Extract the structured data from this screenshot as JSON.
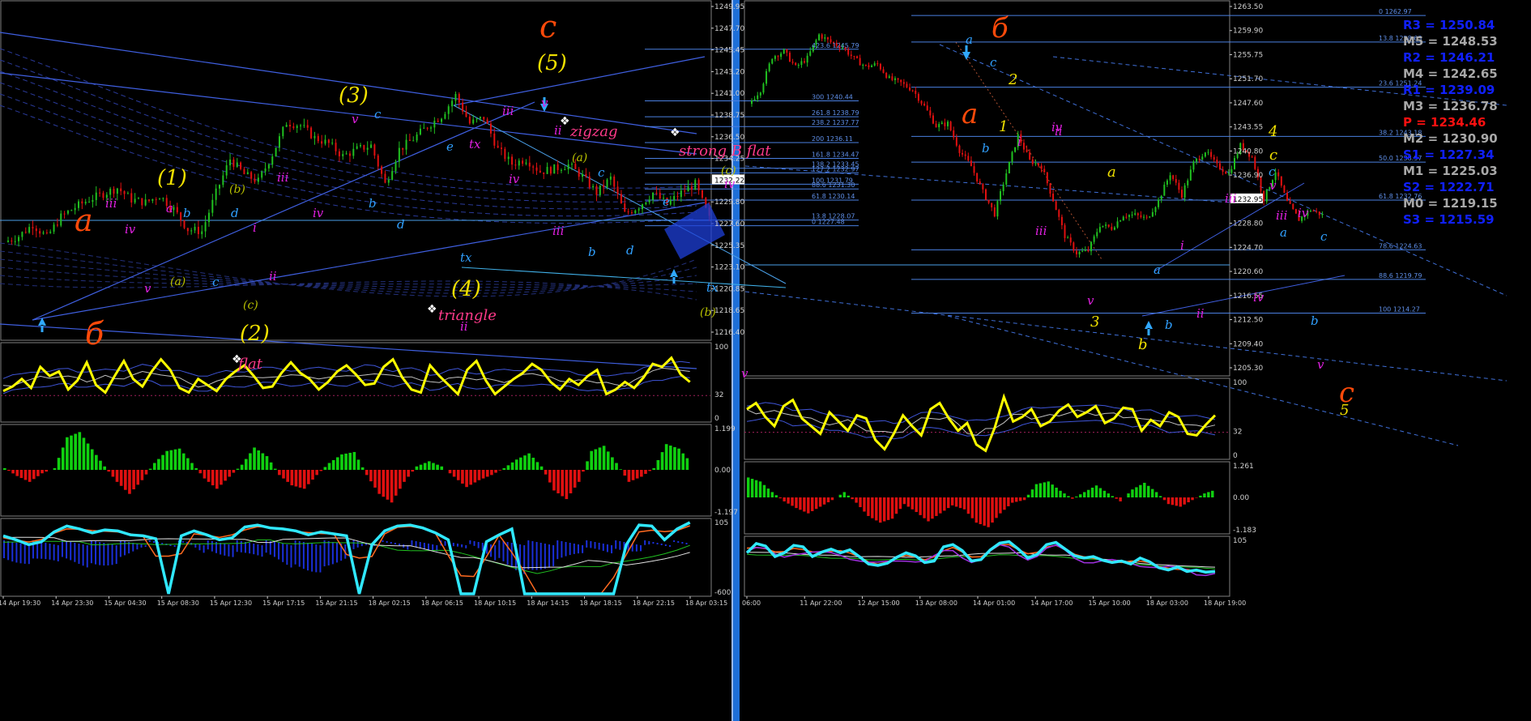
{
  "colors": {
    "background": "#000000",
    "panel_border": "#7f7f7f",
    "window_separator": "#1e6fd8",
    "price_axis_text": "#d0d0d0",
    "trendline": "#3f5fe0",
    "fib_line": "#4a7fe0",
    "wave_orange": "#ff4a0a",
    "wave_yellow": "#f0e000",
    "wave_magenta": "#e020e0",
    "wave_cyan": "#30a0ff",
    "wave_olive": "#b8c000",
    "candle_up": "#20c020",
    "candle_down": "#e01010",
    "osc_main": "#ffff00",
    "hist_up": "#10d010",
    "hist_down": "#e01010",
    "osc_cyan": "#30e8ff",
    "pivot_blue": "#1020ff",
    "pivot_gray": "#a8a8a8",
    "pivot_red": "#ff1010"
  },
  "chart_data": [
    {
      "type": "candlestick",
      "window": "left",
      "price_axis": [
        "1249.95",
        "1247.70",
        "1245.45",
        "1243.20",
        "1241.00",
        "1238.75",
        "1236.50",
        "1234.25",
        "1232.22",
        "1229.80",
        "1227.60",
        "1225.35",
        "1223.10",
        "1220.85",
        "1218.65",
        "1216.40"
      ],
      "current_price": "1232.22",
      "ylim": [
        1215.6,
        1250.9
      ],
      "close_path": [
        1225.8,
        1226.4,
        1227.6,
        1226.3,
        1228.4,
        1229.4,
        1230.2,
        1230.8,
        1231.4,
        1230.2,
        1229.9,
        1230.6,
        1229.2,
        1227.1,
        1226.9,
        1230.9,
        1234.4,
        1232.8,
        1232.1,
        1234.9,
        1238.2,
        1237.9,
        1236.6,
        1236.0,
        1234.7,
        1235.4,
        1235.8,
        1231.8,
        1235.4,
        1236.5,
        1237.8,
        1238.9,
        1241.0,
        1238.1,
        1238.7,
        1235.4,
        1233.9,
        1234.4,
        1233.1,
        1233.4,
        1233.8,
        1232.6,
        1230.9,
        1232.4,
        1228.7,
        1229.5,
        1230.9,
        1229.7,
        1230.9,
        1231.8,
        1228.2
      ],
      "fib_levels": [
        {
          "label": "423.6 1245.79",
          "price": 1245.79
        },
        {
          "label": "300 1240.44",
          "price": 1240.44
        },
        {
          "label": "261.8 1238.79",
          "price": 1238.79
        },
        {
          "label": "238.2 1237.77",
          "price": 1237.77
        },
        {
          "label": "200 1236.11",
          "price": 1236.11
        },
        {
          "label": "161.8 1234.47",
          "price": 1234.47
        },
        {
          "label": "138.2 1233.45",
          "price": 1233.45
        },
        {
          "label": "127.2 1232.97",
          "price": 1232.97
        },
        {
          "label": "100 1231.79",
          "price": 1231.79
        },
        {
          "label": "88.6 1231.30",
          "price": 1231.3
        },
        {
          "label": "61.8 1230.14",
          "price": 1230.14
        },
        {
          "label": "13.8 1228.07",
          "price": 1228.07
        },
        {
          "label": "0 1227.48",
          "price": 1227.48
        }
      ],
      "time_axis": [
        "14 Apr 19:30",
        "14 Apr 23:30",
        "15 Apr 04:30",
        "15 Apr 08:30",
        "15 Apr 12:30",
        "15 Apr 17:15",
        "15 Apr 21:15",
        "18 Apr 02:15",
        "18 Apr 06:15",
        "18 Apr 10:15",
        "18 Apr 14:15",
        "18 Apr 18:15",
        "18 Apr 22:15",
        "18 Apr 03:15"
      ],
      "annotations": [
        "a",
        "б",
        "c",
        "(1)",
        "(2)",
        "(3)",
        "(4)",
        "(5)",
        "flat",
        "triangle",
        "zigzag",
        "strong B flat",
        "(a)",
        "(b)",
        "(c)",
        "i",
        "ii",
        "iii",
        "iv",
        "v",
        "a",
        "b",
        "c",
        "d",
        "e",
        "tx"
      ]
    },
    {
      "type": "candlestick",
      "window": "right",
      "price_axis": [
        "1263.50",
        "1259.90",
        "1255.75",
        "1251.70",
        "1247.60",
        "1243.55",
        "1240.80",
        "1236.90",
        "1232.95",
        "1228.80",
        "1224.70",
        "1220.60",
        "1216.55",
        "1212.50",
        "1209.40",
        "1205.30"
      ],
      "current_price": "1232.95",
      "ylim": [
        1204.0,
        1265.5
      ],
      "close_path": [
        1248.5,
        1250.8,
        1256.2,
        1257.1,
        1254.5,
        1256.0,
        1259.8,
        1258.6,
        1257.8,
        1255.9,
        1254.6,
        1255.0,
        1252.6,
        1251.9,
        1250.8,
        1248.1,
        1244.9,
        1245.3,
        1240.9,
        1238.3,
        1234.1,
        1230.5,
        1237.2,
        1243.3,
        1239.2,
        1238.3,
        1232.8,
        1226.9,
        1224.1,
        1224.5,
        1228.7,
        1228.2,
        1230.3,
        1230.3,
        1229.7,
        1232.7,
        1237.1,
        1233.6,
        1238.8,
        1240.8,
        1238.4,
        1237.1,
        1241.7,
        1239.8,
        1232.9,
        1237.5,
        1232.4,
        1229.6,
        1231.2,
        1230.3
      ],
      "fib_levels": [
        {
          "label": "0 1262.97",
          "price": 1262.97
        },
        {
          "label": "13.8 1258.63",
          "price": 1258.63
        },
        {
          "label": "23.6 1251.24",
          "price": 1251.24
        },
        {
          "label": "38.2 1243.18",
          "price": 1243.18
        },
        {
          "label": "50.0 1238.97",
          "price": 1238.97
        },
        {
          "label": "61.8 1232.76",
          "price": 1232.76
        },
        {
          "label": "78.6 1224.63",
          "price": 1224.63
        },
        {
          "label": "88.6 1219.79",
          "price": 1219.79
        },
        {
          "label": "100 1214.27",
          "price": 1214.27
        }
      ],
      "pivots": [
        {
          "label": "R3 = 1250.84",
          "kind": "blue"
        },
        {
          "label": "M5 = 1248.53",
          "kind": "gray"
        },
        {
          "label": "R2 = 1246.21",
          "kind": "blue"
        },
        {
          "label": "M4 = 1242.65",
          "kind": "gray"
        },
        {
          "label": "R1 = 1239.09",
          "kind": "blue"
        },
        {
          "label": "M3 = 1236.78",
          "kind": "gray"
        },
        {
          "label": "P = 1234.46",
          "kind": "red"
        },
        {
          "label": "M2 = 1230.90",
          "kind": "gray"
        },
        {
          "label": "S1 = 1227.34",
          "kind": "blue"
        },
        {
          "label": "M1 = 1225.03",
          "kind": "gray"
        },
        {
          "label": "S2 = 1222.71",
          "kind": "blue"
        },
        {
          "label": "M0 = 1219.15",
          "kind": "gray"
        },
        {
          "label": "S3 = 1215.59",
          "kind": "blue"
        }
      ],
      "time_axis": [
        "06:00",
        "11 Apr 22:00",
        "12 Apr 15:00",
        "13 Apr 08:00",
        "14 Apr 01:00",
        "14 Apr 17:00",
        "15 Apr 10:00",
        "18 Apr 03:00",
        "18 Apr 19:00"
      ],
      "annotations": [
        "б",
        "a",
        "c",
        "2",
        "1",
        "i",
        "ii",
        "iii",
        "iv",
        "v",
        "a",
        "3",
        "b",
        "4",
        "c",
        "5"
      ]
    }
  ],
  "indicators": {
    "left": {
      "osc1_axis": [
        "100",
        "32",
        "0"
      ],
      "osc2_axis": [
        "1.199",
        "0.00",
        "-1.197"
      ],
      "osc3_axis": [
        "105",
        "-600"
      ],
      "osc1_values": [
        38,
        44,
        54,
        42,
        70,
        58,
        64,
        40,
        52,
        76,
        46,
        36,
        58,
        78,
        54,
        44,
        64,
        80,
        66,
        42,
        36,
        54,
        46,
        38,
        54,
        64,
        72,
        58,
        42,
        44,
        62,
        76,
        62,
        54,
        40,
        50,
        64,
        72,
        60,
        46,
        48,
        70,
        80,
        56,
        40,
        36,
        72,
        58,
        46,
        34,
        66,
        78,
        52,
        34,
        44,
        54,
        62,
        74,
        66,
        50,
        40,
        54,
        46,
        58,
        66,
        34,
        40,
        50,
        42,
        56,
        74,
        70,
        82,
        60,
        50
      ],
      "osc2_values": [
        0.05,
        -0.18,
        -0.35,
        -0.1,
        0.05,
        0.95,
        1.1,
        0.6,
        0.1,
        -0.35,
        -0.7,
        -0.3,
        0.2,
        0.55,
        0.62,
        0.2,
        -0.25,
        -0.55,
        -0.2,
        0.15,
        0.65,
        0.4,
        -0.15,
        -0.45,
        -0.55,
        -0.15,
        0.2,
        0.45,
        0.52,
        -0.15,
        -0.7,
        -0.95,
        -0.35,
        0.1,
        0.25,
        0.1,
        -0.2,
        -0.5,
        -0.3,
        -0.15,
        0.05,
        0.3,
        0.48,
        0.1,
        -0.6,
        -0.85,
        -0.35,
        0.55,
        0.7,
        0.2,
        -0.35,
        -0.2,
        0.05,
        0.75,
        0.62,
        0.2
      ],
      "osc3_values": [
        78,
        70,
        60,
        66,
        86,
        98,
        92,
        84,
        90,
        88,
        80,
        78,
        72,
        -600,
        78,
        88,
        80,
        70,
        74,
        96,
        100,
        94,
        92,
        88,
        80,
        86,
        82,
        78,
        -200,
        60,
        88,
        98,
        100,
        94,
        84,
        70,
        -180,
        -160,
        66,
        80,
        92,
        -240,
        -300,
        -320,
        -340,
        -360,
        -300,
        -220,
        -120,
        60,
        100,
        98,
        70,
        92,
        105
      ]
    },
    "right": {
      "osc1_axis": [
        "100",
        "32",
        "0"
      ],
      "osc2_axis": [
        "1.261",
        "0.00",
        "-1.183"
      ],
      "osc3_axis": [
        "105"
      ],
      "osc1_values": [
        62,
        70,
        52,
        40,
        66,
        74,
        50,
        40,
        30,
        58,
        46,
        34,
        54,
        50,
        22,
        10,
        30,
        54,
        40,
        28,
        62,
        70,
        50,
        34,
        44,
        16,
        8,
        38,
        78,
        46,
        52,
        62,
        40,
        46,
        60,
        68,
        52,
        58,
        66,
        44,
        50,
        64,
        62,
        34,
        48,
        40,
        58,
        52,
        30,
        28,
        42,
        54
      ],
      "osc2_values": [
        0.75,
        0.6,
        0.2,
        -0.15,
        -0.4,
        -0.6,
        -0.35,
        -0.1,
        0.2,
        -0.2,
        -0.7,
        -0.95,
        -0.8,
        -0.25,
        -0.55,
        -0.9,
        -0.6,
        -0.3,
        -0.45,
        -0.95,
        -1.12,
        -0.6,
        -0.2,
        -0.1,
        0.5,
        0.6,
        0.25,
        -0.05,
        0.2,
        0.45,
        0.15,
        -0.15,
        0.3,
        0.55,
        0.2,
        -0.25,
        -0.35,
        -0.1,
        0.15,
        0.3
      ],
      "osc3_values": [
        70,
        95,
        88,
        60,
        70,
        90,
        86,
        60,
        72,
        80,
        70,
        78,
        60,
        40,
        36,
        42,
        58,
        70,
        62,
        44,
        48,
        86,
        92,
        76,
        48,
        52,
        78,
        96,
        100,
        80,
        56,
        66,
        92,
        98,
        80,
        62,
        56,
        60,
        50,
        44,
        48,
        40,
        56,
        46,
        30,
        24,
        32,
        20,
        24,
        18,
        20
      ]
    }
  }
}
